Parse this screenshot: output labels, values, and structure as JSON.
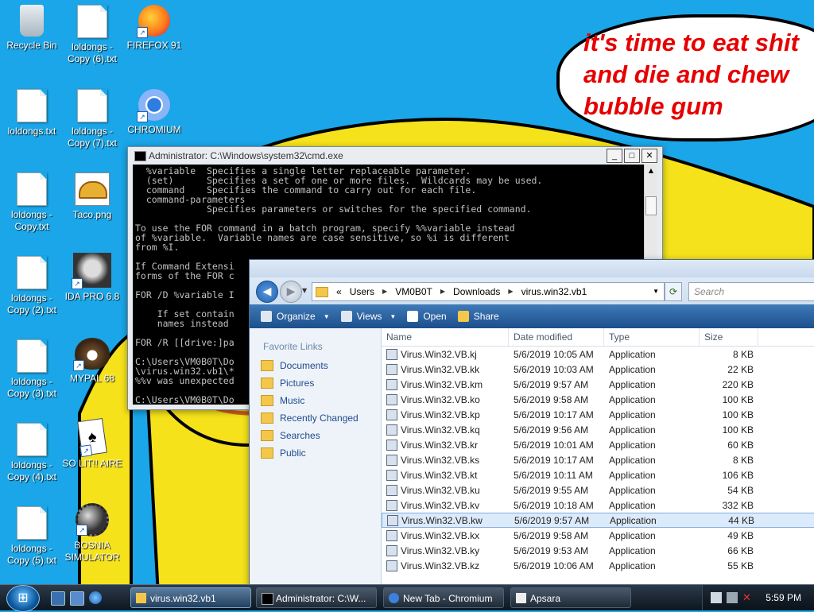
{
  "wallpaper": {
    "speech_bubble": "it's time to eat shit\nand die and chew\nbubble gum"
  },
  "desktop_icons": [
    {
      "label": "Recycle Bin",
      "icon": "recycle-bin-icon"
    },
    {
      "label": "loldongs - Copy (6).txt",
      "icon": "text-file-icon"
    },
    {
      "label": "FIREFOX 91",
      "icon": "firefox-icon"
    },
    {
      "label": "loldongs.txt",
      "icon": "text-file-icon"
    },
    {
      "label": "loldongs - Copy (7).txt",
      "icon": "text-file-icon"
    },
    {
      "label": "CHROMIUM",
      "icon": "chromium-icon"
    },
    {
      "label": "loldongs - Copy.txt",
      "icon": "text-file-icon"
    },
    {
      "label": "Taco.png",
      "icon": "image-file-icon"
    },
    {
      "label": "loldongs - Copy (2).txt",
      "icon": "text-file-icon"
    },
    {
      "label": "IDA PRO 6.8",
      "icon": "ida-pro-icon"
    },
    {
      "label": "loldongs - Copy (3).txt",
      "icon": "text-file-icon"
    },
    {
      "label": "MYPAL 68",
      "icon": "mypal-icon"
    },
    {
      "label": "loldongs - Copy (4).txt",
      "icon": "text-file-icon"
    },
    {
      "label": "SO LIT!! AIRE",
      "icon": "solitaire-icon"
    },
    {
      "label": "loldongs - Copy (5).txt",
      "icon": "text-file-icon"
    },
    {
      "label": "BOSNIA SIMULATOR",
      "icon": "mine-icon"
    }
  ],
  "cmd": {
    "title": "Administrator: C:\\Windows\\system32\\cmd.exe",
    "text": "  %variable  Specifies a single letter replaceable parameter.\n  (set)      Specifies a set of one or more files.  Wildcards may be used.\n  command    Specifies the command to carry out for each file.\n  command-parameters\n             Specifies parameters or switches for the specified command.\n\nTo use the FOR command in a batch program, specify %%variable instead\nof %variable.  Variable names are case sensitive, so %i is different\nfrom %I.\n\nIf Command Extensi\nforms of the FOR c\n\nFOR /D %variable I\n\n    If set contain\n    names instead\n\nFOR /R [[drive:]pa\n\nC:\\Users\\VM0B0T\\Do\n\\virus.win32.vb1\\*\n%%v was unexpected\n\nC:\\Users\\VM0B0T\\Do"
  },
  "explorer": {
    "breadcrumb": [
      "«",
      "Users",
      "VM0B0T",
      "Downloads",
      "virus.win32.vb1"
    ],
    "search_placeholder": "Search",
    "toolbar": {
      "organize": "Organize",
      "views": "Views",
      "open": "Open",
      "share": "Share"
    },
    "favorites_heading": "Favorite Links",
    "favorites": [
      "Documents",
      "Pictures",
      "Music",
      "Recently Changed",
      "Searches",
      "Public"
    ],
    "columns": {
      "name": "Name",
      "date": "Date modified",
      "type": "Type",
      "size": "Size"
    },
    "files": [
      {
        "name": "Virus.Win32.VB.kj",
        "date": "5/6/2019 10:05 AM",
        "type": "Application",
        "size": "8 KB"
      },
      {
        "name": "Virus.Win32.VB.kk",
        "date": "5/6/2019 10:03 AM",
        "type": "Application",
        "size": "22 KB"
      },
      {
        "name": "Virus.Win32.VB.km",
        "date": "5/6/2019 9:57 AM",
        "type": "Application",
        "size": "220 KB"
      },
      {
        "name": "Virus.Win32.VB.ko",
        "date": "5/6/2019 9:58 AM",
        "type": "Application",
        "size": "100 KB"
      },
      {
        "name": "Virus.Win32.VB.kp",
        "date": "5/6/2019 10:17 AM",
        "type": "Application",
        "size": "100 KB"
      },
      {
        "name": "Virus.Win32.VB.kq",
        "date": "5/6/2019 9:56 AM",
        "type": "Application",
        "size": "100 KB"
      },
      {
        "name": "Virus.Win32.VB.kr",
        "date": "5/6/2019 10:01 AM",
        "type": "Application",
        "size": "60 KB"
      },
      {
        "name": "Virus.Win32.VB.ks",
        "date": "5/6/2019 10:17 AM",
        "type": "Application",
        "size": "8 KB"
      },
      {
        "name": "Virus.Win32.VB.kt",
        "date": "5/6/2019 10:11 AM",
        "type": "Application",
        "size": "106 KB"
      },
      {
        "name": "Virus.Win32.VB.ku",
        "date": "5/6/2019 9:55 AM",
        "type": "Application",
        "size": "54 KB"
      },
      {
        "name": "Virus.Win32.VB.kv",
        "date": "5/6/2019 10:18 AM",
        "type": "Application",
        "size": "332 KB"
      },
      {
        "name": "Virus.Win32.VB.kw",
        "date": "5/6/2019 9:57 AM",
        "type": "Application",
        "size": "44 KB"
      },
      {
        "name": "Virus.Win32.VB.kx",
        "date": "5/6/2019 9:58 AM",
        "type": "Application",
        "size": "49 KB"
      },
      {
        "name": "Virus.Win32.VB.ky",
        "date": "5/6/2019 9:53 AM",
        "type": "Application",
        "size": "66 KB"
      },
      {
        "name": "Virus.Win32.VB.kz",
        "date": "5/6/2019 10:06 AM",
        "type": "Application",
        "size": "55 KB"
      }
    ],
    "selected_row": 11
  },
  "taskbar": {
    "buttons": [
      "virus.win32.vb1",
      "Administrator: C:\\W...",
      "New Tab - Chromium",
      "Apsara"
    ],
    "clock": "5:59 PM"
  },
  "colors": {
    "desktop": "#1aa6e8",
    "bubble_text": "#e60000",
    "toolbar": "#1c4f8c"
  }
}
